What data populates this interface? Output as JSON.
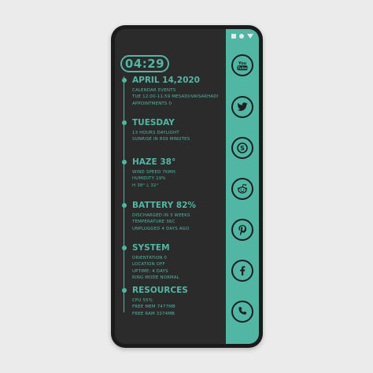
{
  "colors": {
    "accent": "#52b6a5",
    "screen_bg": "#2b2b2b",
    "frame": "#1b1b1b",
    "page_bg": "#ebebeb"
  },
  "clock": {
    "time": "04:29"
  },
  "sections": [
    {
      "title": "APRIL 14,2020",
      "lines": [
        "CALENDAR EVENTS",
        "TUE 12:00-11:59 MESADI/VAISAKHADI",
        "APPOINTMENTS  0"
      ]
    },
    {
      "title": "TUESDAY",
      "lines": [
        "13 HOURS DAYLIGHT",
        "SUNRISE IN 809 MINUTES"
      ]
    },
    {
      "title": "HAZE 38°",
      "lines": [
        "WIND SPEED 7KMH.",
        "HUMIDITY 19%",
        "H 38° L 32°"
      ]
    },
    {
      "title": "BATTERY 82%",
      "lines": [
        "DISCHARGED IN 3 WEEKS",
        "TEMPERATURE 36C",
        "UNPLUGGED 4 DAYS AGO"
      ]
    },
    {
      "title": "SYSTEM",
      "lines": [
        "ORIENTATION 0",
        "LOCATION OFF",
        "UPTIME: 4 DAYS",
        "RING MODE NORMAL"
      ]
    },
    {
      "title": "RESOURCES",
      "lines": [
        "CPU 55%",
        "FREE MEM 7477MB",
        "FREE RAM 3374MB"
      ]
    }
  ],
  "sidebar": {
    "icons": [
      "youtube-icon",
      "twitter-icon",
      "skype-icon",
      "reddit-icon",
      "pinterest-icon",
      "facebook-icon",
      "phone-icon"
    ],
    "youtube_label": [
      "You",
      "Tube"
    ]
  }
}
